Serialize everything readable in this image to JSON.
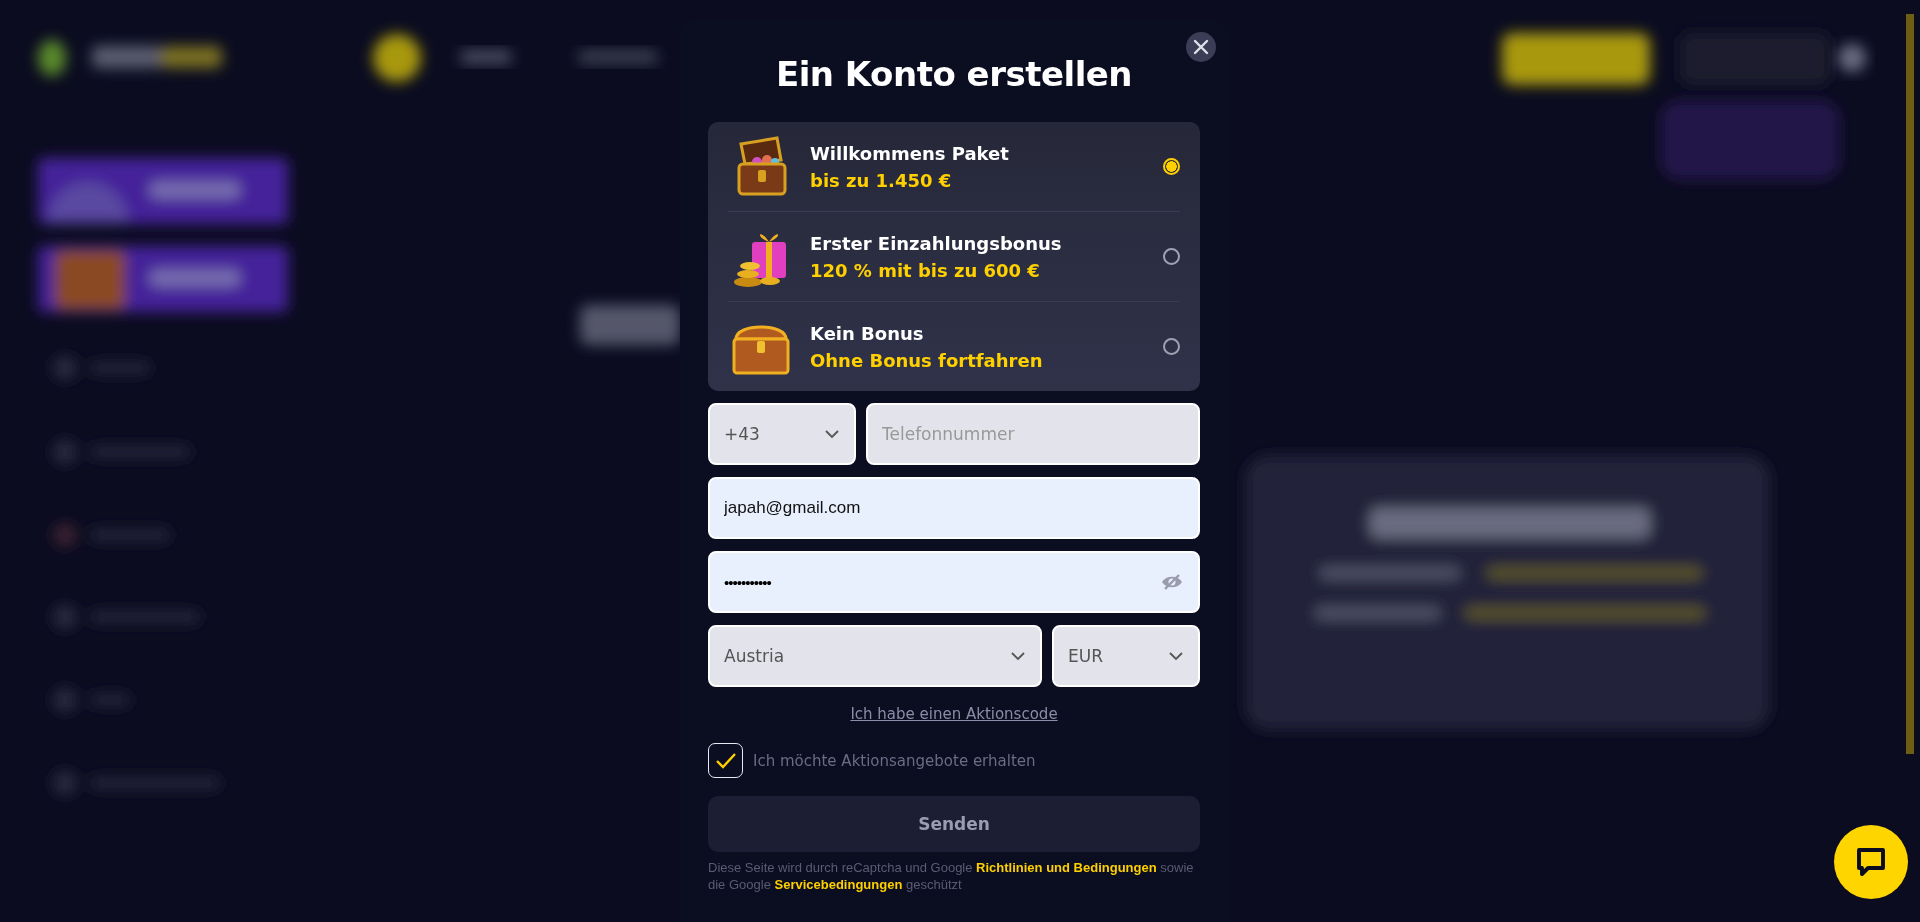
{
  "modal": {
    "title": "Ein Konto erstellen",
    "bonus_options": [
      {
        "kind": "gem-chest",
        "title": "Willkommens Paket",
        "subtitle": "bis zu 1.450 €",
        "selected": true
      },
      {
        "kind": "gift-coins",
        "title": "Erster Einzahlungsbonus",
        "subtitle": "120 % mit bis zu 600 €",
        "selected": false
      },
      {
        "kind": "chest",
        "title": "Kein Bonus",
        "subtitle": "Ohne Bonus fortfahren",
        "selected": false
      }
    ],
    "phone": {
      "country_code": "+43",
      "placeholder": "Telefonnummer"
    },
    "email": {
      "value": "japah@gmail.com"
    },
    "password": {
      "value": "•••••••••••"
    },
    "country": {
      "value": "Austria"
    },
    "currency": {
      "value": "EUR"
    },
    "promo_code_link": "Ich habe einen Aktionscode",
    "promo_opt_in": {
      "label": "Ich möchte Aktionsangebote erhalten",
      "checked": true
    },
    "submit": "Senden",
    "recaptcha_notice": [
      {
        "kind": "text",
        "text": "Diese Seite wird durch reCaptcha und Google"
      },
      {
        "kind": "link",
        "text": "Richtlinien und Bedingungen"
      },
      {
        "kind": "text",
        "text": "sowie die Google"
      },
      {
        "kind": "link",
        "text": "Servicebedingungen"
      },
      {
        "kind": "text",
        "text": "geschützt"
      }
    ]
  }
}
